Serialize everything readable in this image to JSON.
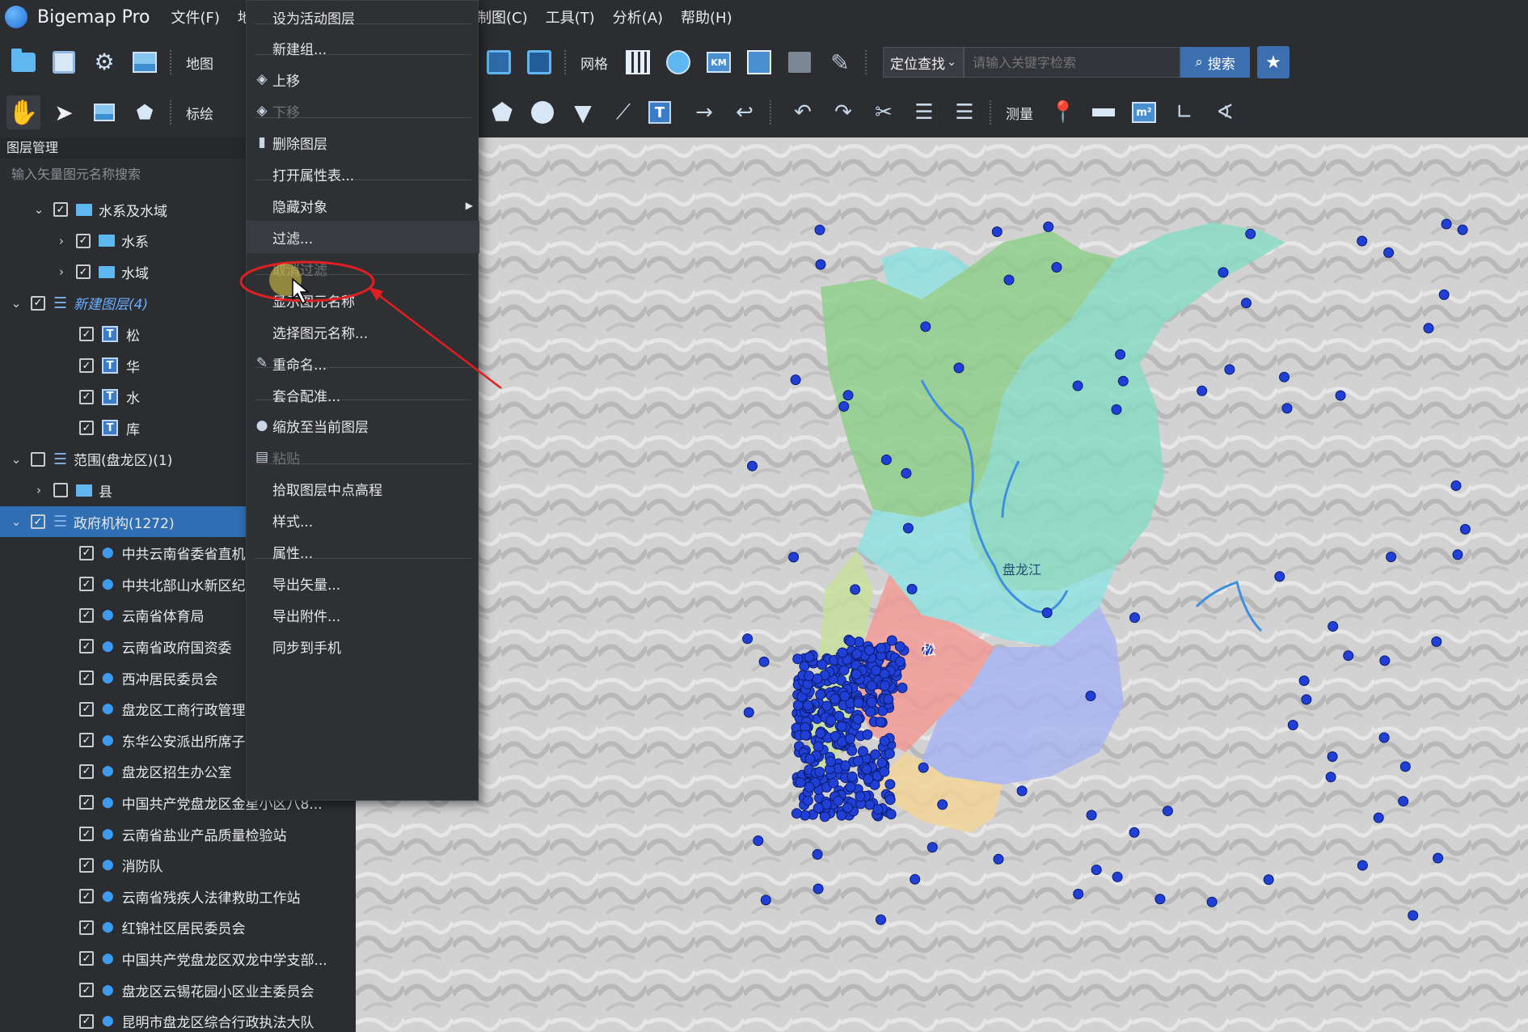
{
  "app": {
    "title": "Bigemap Pro"
  },
  "menubar": {
    "left": [
      "文件(F)",
      "地图"
    ],
    "right": [
      "制图(C)",
      "工具(T)",
      "分析(A)",
      "帮助(H)"
    ]
  },
  "toolbar1": {
    "map_label": "地图",
    "grid_label": "网格",
    "search": {
      "mode": "定位查找",
      "placeholder": "请输入关键字检索",
      "button": "搜索"
    }
  },
  "toolbar2": {
    "annotate_label": "标绘",
    "measure_label": "测量"
  },
  "layer_panel": {
    "title": "图层管理",
    "search_placeholder": "输入矢量图元名称搜索",
    "rows": [
      {
        "label": "水系及水域",
        "checked": true,
        "icon": "folder-icon",
        "expander": "down"
      },
      {
        "label": "水系",
        "checked": true,
        "icon": "folder-icon",
        "expander": "right"
      },
      {
        "label": "水域",
        "checked": true,
        "icon": "folder-icon",
        "expander": "right"
      },
      {
        "label": "新建图层(4)",
        "checked": true,
        "icon": "layers-icon",
        "expander": "down"
      },
      {
        "label": "松",
        "checked": true,
        "icon": "text-layer-icon"
      },
      {
        "label": "华",
        "checked": true,
        "icon": "text-layer-icon"
      },
      {
        "label": "水",
        "checked": true,
        "icon": "text-layer-icon"
      },
      {
        "label": "库",
        "checked": true,
        "icon": "text-layer-icon"
      },
      {
        "label": "范围(盘龙区)(1)",
        "checked": false,
        "icon": "layers-icon",
        "expander": "down"
      },
      {
        "label": "县",
        "checked": false,
        "icon": "folder-icon",
        "expander": "right"
      },
      {
        "label": "政府机构(1272)",
        "checked": true,
        "icon": "layers-icon",
        "expander": "down"
      },
      {
        "label": "中共云南省委省直机",
        "checked": true,
        "icon": "pin-icon"
      },
      {
        "label": "中共北部山水新区纪",
        "checked": true,
        "icon": "pin-icon"
      },
      {
        "label": "云南省体育局",
        "checked": true,
        "icon": "pin-icon"
      },
      {
        "label": "云南省政府国资委",
        "checked": true,
        "icon": "pin-icon"
      },
      {
        "label": "西冲居民委员会",
        "checked": true,
        "icon": "pin-icon"
      },
      {
        "label": "盘龙区工商行政管理",
        "checked": true,
        "icon": "pin-icon"
      },
      {
        "label": "东华公安派出所席子",
        "checked": true,
        "icon": "pin-icon"
      },
      {
        "label": "盘龙区招生办公室",
        "checked": true,
        "icon": "pin-icon"
      },
      {
        "label": "中国共产党盘龙区金星小区八8...",
        "checked": true,
        "icon": "pin-icon"
      },
      {
        "label": "云南省盐业产品质量检验站",
        "checked": true,
        "icon": "pin-icon"
      },
      {
        "label": "消防队",
        "checked": true,
        "icon": "pin-icon"
      },
      {
        "label": "云南省残疾人法律救助工作站",
        "checked": true,
        "icon": "pin-icon"
      },
      {
        "label": "红锦社区居民委员会",
        "checked": true,
        "icon": "pin-icon"
      },
      {
        "label": "中国共产党盘龙区双龙中学支部...",
        "checked": true,
        "icon": "pin-icon"
      },
      {
        "label": "盘龙区云锡花园小区业主委员会",
        "checked": true,
        "icon": "pin-icon"
      },
      {
        "label": "昆明市盘龙区综合行政执法大队",
        "checked": true,
        "icon": "pin-icon"
      }
    ]
  },
  "context_menu": {
    "items": [
      {
        "label": "设为活动图层",
        "icon": ""
      },
      {
        "label": "新建组...",
        "icon": ""
      },
      {
        "label": "上移",
        "icon": "layers-up-icon"
      },
      {
        "label": "下移",
        "icon": "layers-down-icon",
        "disabled": true
      },
      {
        "label": "删除图层",
        "icon": "trash-icon"
      },
      {
        "label": "打开属性表...",
        "icon": ""
      },
      {
        "label": "隐藏对象",
        "icon": "",
        "submenu": true
      },
      {
        "label": "过滤...",
        "icon": "",
        "hover": true
      },
      {
        "label": "取消过滤",
        "icon": "",
        "disabled": true
      },
      {
        "label": "显示图元名称",
        "icon": ""
      },
      {
        "label": "选择图元名称...",
        "icon": ""
      },
      {
        "label": "重命名...",
        "icon": "rename-icon"
      },
      {
        "label": "套合配准...",
        "icon": ""
      },
      {
        "label": "缩放至当前图层",
        "icon": "user-zoom-icon"
      },
      {
        "label": "粘贴",
        "icon": "paste-icon",
        "disabled": true
      },
      {
        "label": "拾取图层中点高程",
        "icon": ""
      },
      {
        "label": "样式...",
        "icon": ""
      },
      {
        "label": "属性...",
        "icon": ""
      },
      {
        "label": "导出矢量...",
        "icon": ""
      },
      {
        "label": "导出附件...",
        "icon": ""
      },
      {
        "label": "同步到手机",
        "icon": ""
      }
    ]
  },
  "map": {
    "labels": {
      "river": "盘龙江",
      "town": "松"
    },
    "colors": {
      "point": "#1f3fd6",
      "zone_green": "#8ed08a",
      "zone_teal": "#86dcc4",
      "zone_cyan": "#8fe3e3",
      "zone_pink": "#f39a95",
      "zone_purple": "#a7b4f3",
      "zone_yellow": "#f3d596",
      "zone_lime": "#c8e09a",
      "river": "#3f8fe0",
      "annotation": "#e02020"
    }
  }
}
